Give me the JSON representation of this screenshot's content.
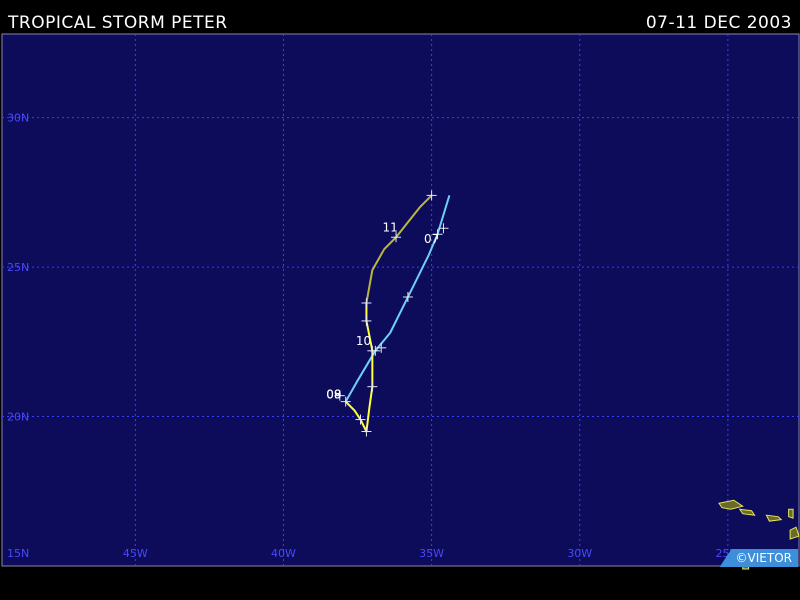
{
  "header": {
    "title": "TROPICAL STORM PETER",
    "dates": "07-11 DEC 2003"
  },
  "credit": "©VIETOR",
  "colors": {
    "ocean": "#0c0c5a",
    "grid": "#3d3dff",
    "grid_label": "#4848ff",
    "track_tropical_storm": "#ffff3c",
    "track_depression": "#6ed0f8",
    "track_extratropical": "#b8b840",
    "land": "#6a6a2a"
  },
  "map": {
    "lat_labels": [
      "30N",
      "25N",
      "20N",
      "15N"
    ],
    "lon_labels": [
      "45W",
      "40W",
      "35W",
      "30W",
      "25W"
    ],
    "lat_range": [
      15,
      32.8
    ],
    "lon_range": [
      -49.5,
      -22.6
    ]
  },
  "storm_track": {
    "description_labels": [
      "07",
      "08",
      "09",
      "10",
      "11"
    ],
    "segments": [
      {
        "stage": "depression",
        "points": [
          [
            -34.4,
            27.4
          ],
          [
            -34.8,
            26.1
          ],
          [
            -35.1,
            25.4
          ],
          [
            -35.8,
            24.0
          ],
          [
            -36.4,
            22.8
          ],
          [
            -36.9,
            22.2
          ],
          [
            -37.5,
            21.2
          ],
          [
            -37.9,
            20.5
          ]
        ]
      },
      {
        "stage": "tropical_storm",
        "points": [
          [
            -37.9,
            20.5
          ],
          [
            -37.6,
            20.2
          ],
          [
            -37.4,
            19.9
          ],
          [
            -37.2,
            19.5
          ],
          [
            -37.1,
            20.3
          ],
          [
            -37.0,
            21.0
          ],
          [
            -37.0,
            21.6
          ],
          [
            -37.0,
            22.2
          ],
          [
            -37.1,
            22.7
          ],
          [
            -37.2,
            23.2
          ],
          [
            -37.2,
            23.8
          ]
        ]
      },
      {
        "stage": "extratropical",
        "points": [
          [
            -37.2,
            23.8
          ],
          [
            -37.0,
            24.9
          ],
          [
            -36.6,
            25.6
          ],
          [
            -36.2,
            26.0
          ],
          [
            -35.8,
            26.5
          ],
          [
            -35.4,
            27.0
          ],
          [
            -35.0,
            27.4
          ]
        ]
      }
    ],
    "ticks": [
      [
        -34.8,
        26.1
      ],
      [
        -35.8,
        24.0
      ],
      [
        -36.9,
        22.2
      ],
      [
        -37.9,
        20.5
      ],
      [
        -37.4,
        19.9
      ],
      [
        -37.2,
        19.5
      ],
      [
        -37.0,
        21.0
      ],
      [
        -37.0,
        22.2
      ],
      [
        -37.2,
        23.2
      ],
      [
        -37.2,
        23.8
      ],
      [
        -36.2,
        26.0
      ],
      [
        -35.0,
        27.4
      ],
      [
        -38.1,
        20.7
      ],
      [
        -36.7,
        22.3
      ],
      [
        -34.6,
        26.3
      ]
    ],
    "day_labels": [
      {
        "text": "07",
        "lon": -35.0,
        "lat": 25.8
      },
      {
        "text": "08",
        "lon": -38.3,
        "lat": 20.6
      },
      {
        "text": "09",
        "lon": -38.3,
        "lat": 20.6
      },
      {
        "text": "10",
        "lon": -37.3,
        "lat": 22.4
      },
      {
        "text": "11",
        "lon": -36.4,
        "lat": 26.2
      }
    ]
  },
  "islands": [
    {
      "name": "cape-verde-santo-antao",
      "points": [
        [
          -25.3,
          17.1
        ],
        [
          -24.8,
          17.2
        ],
        [
          -24.5,
          17.0
        ],
        [
          -24.9,
          16.9
        ],
        [
          -25.2,
          16.95
        ]
      ]
    },
    {
      "name": "cape-verde-sao-vicente",
      "points": [
        [
          -24.6,
          16.9
        ],
        [
          -24.2,
          16.85
        ],
        [
          -24.1,
          16.7
        ],
        [
          -24.5,
          16.75
        ]
      ]
    },
    {
      "name": "cape-verde-sao-nicolau",
      "points": [
        [
          -23.7,
          16.7
        ],
        [
          -23.3,
          16.65
        ],
        [
          -23.2,
          16.55
        ],
        [
          -23.6,
          16.5
        ]
      ]
    },
    {
      "name": "cape-verde-sal",
      "points": [
        [
          -22.95,
          16.9
        ],
        [
          -22.8,
          16.9
        ],
        [
          -22.8,
          16.6
        ],
        [
          -22.95,
          16.65
        ]
      ]
    },
    {
      "name": "cape-verde-boa-vista",
      "points": [
        [
          -22.9,
          16.2
        ],
        [
          -22.7,
          16.3
        ],
        [
          -22.6,
          16.0
        ],
        [
          -22.9,
          15.9
        ]
      ]
    },
    {
      "name": "cape-verde-santiago",
      "points": [
        [
          -23.8,
          15.4
        ],
        [
          -23.5,
          15.3
        ],
        [
          -23.4,
          15.0
        ],
        [
          -23.7,
          15.0
        ]
      ]
    },
    {
      "name": "cape-verde-fogo",
      "points": [
        [
          -24.5,
          15.1
        ],
        [
          -24.3,
          15.1
        ],
        [
          -24.3,
          14.9
        ],
        [
          -24.5,
          14.9
        ]
      ]
    },
    {
      "name": "cape-verde-maio",
      "points": [
        [
          -23.3,
          15.3
        ],
        [
          -23.1,
          15.3
        ],
        [
          -23.1,
          15.1
        ],
        [
          -23.3,
          15.1
        ]
      ]
    }
  ]
}
